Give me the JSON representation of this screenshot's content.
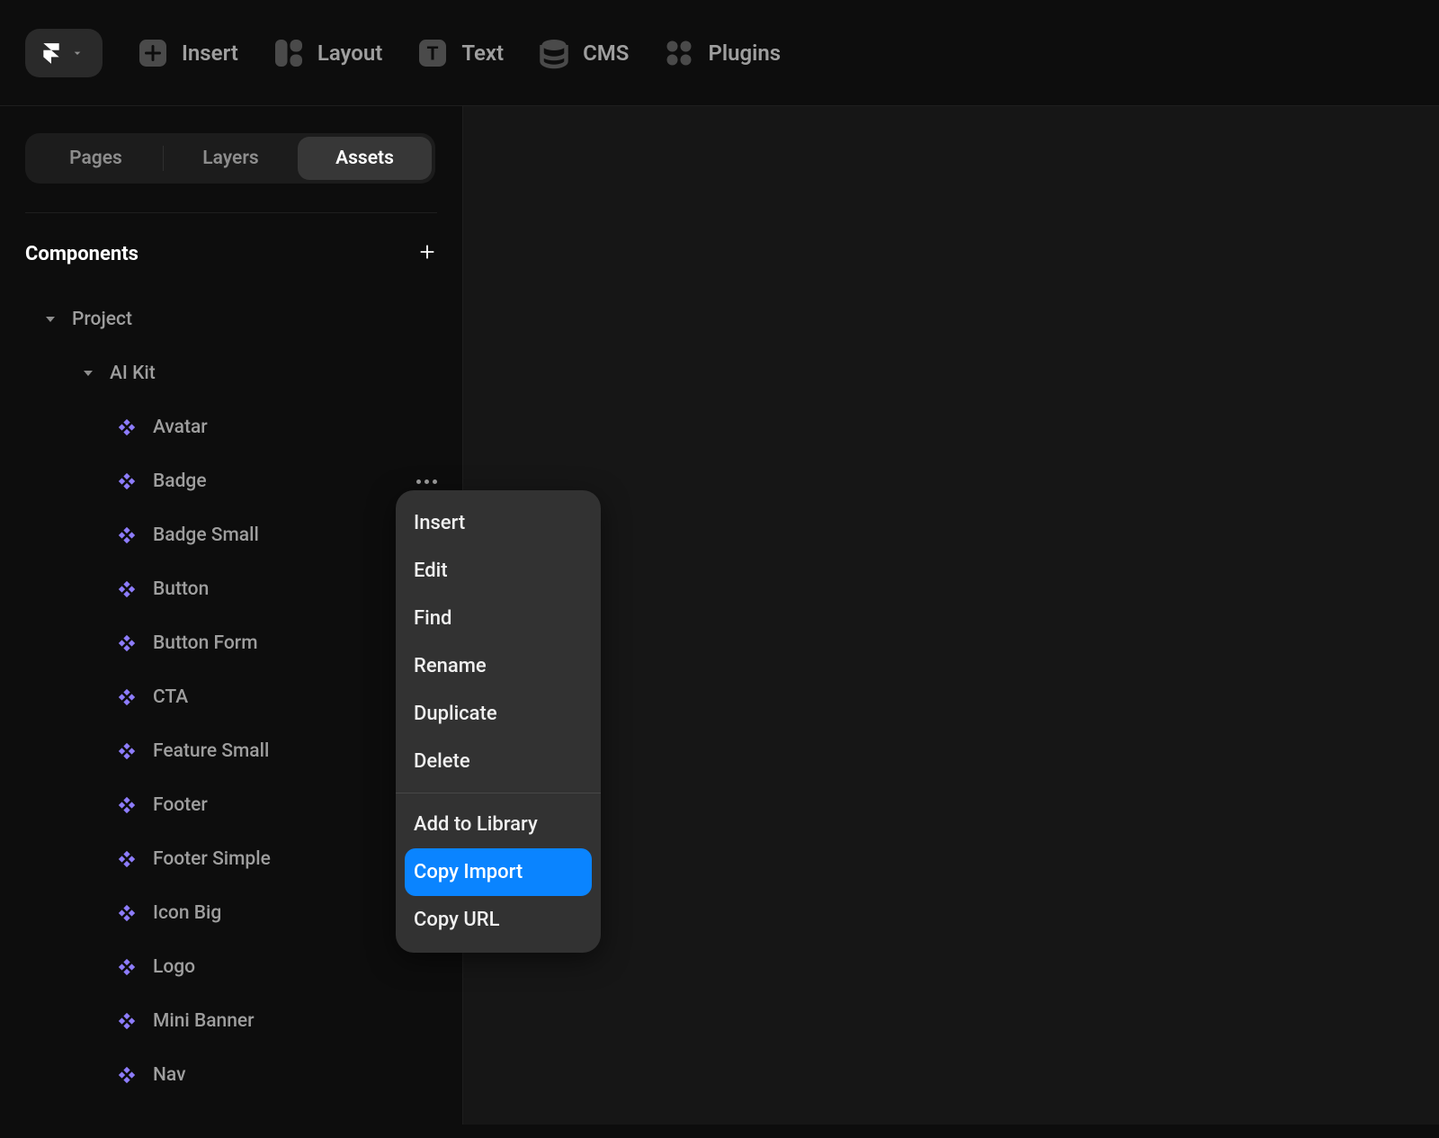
{
  "toolbar": {
    "items": [
      {
        "icon": "plus",
        "label": "Insert"
      },
      {
        "icon": "layout",
        "label": "Layout"
      },
      {
        "icon": "text",
        "label": "Text"
      },
      {
        "icon": "cms",
        "label": "CMS"
      },
      {
        "icon": "plugins",
        "label": "Plugins"
      }
    ]
  },
  "sidebar": {
    "tabs": [
      "Pages",
      "Layers",
      "Assets"
    ],
    "active_tab": "Assets",
    "section_title": "Components",
    "tree": {
      "root": "Project",
      "folder": "AI Kit",
      "components": [
        "Avatar",
        "Badge",
        "Badge Small",
        "Button",
        "Button Form",
        "CTA",
        "Feature Small",
        "Footer",
        "Footer Simple",
        "Icon Big",
        "Logo",
        "Mini Banner",
        "Nav"
      ],
      "active_more_on": "Badge"
    }
  },
  "context_menu": {
    "group1": [
      "Insert",
      "Edit",
      "Find",
      "Rename",
      "Duplicate",
      "Delete"
    ],
    "group2": [
      "Add to Library",
      "Copy Import",
      "Copy URL"
    ],
    "highlighted": "Copy Import"
  },
  "colors": {
    "accent_component": "#8d7cfb",
    "selection_blue": "#0a84ff"
  }
}
